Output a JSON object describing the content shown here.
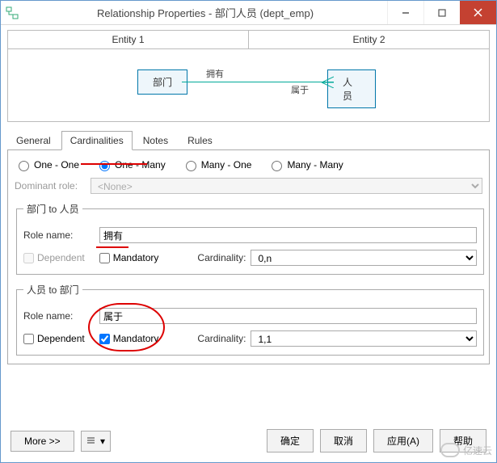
{
  "window": {
    "title": "Relationship Properties - 部门人员 (dept_emp)"
  },
  "entity_header": {
    "e1": "Entity 1",
    "e2": "Entity 2"
  },
  "diagram": {
    "left_entity": "部门",
    "right_entity": "人员",
    "label_left": "拥有",
    "label_right": "属于"
  },
  "tabs": [
    "General",
    "Cardinalities",
    "Notes",
    "Rules"
  ],
  "active_tab": "Cardinalities",
  "cardinality_options": {
    "one_one": "One - One",
    "one_many": "One - Many",
    "many_one": "Many - One",
    "many_many": "Many - Many",
    "selected": "one_many"
  },
  "dominant_role": {
    "label": "Dominant role:",
    "value": "<None>"
  },
  "section_a": {
    "legend": "部门 to 人员",
    "role_label": "Role name:",
    "role_value": "拥有",
    "dependent_label": "Dependent",
    "dependent_checked": false,
    "dependent_enabled": false,
    "mandatory_label": "Mandatory",
    "mandatory_checked": false,
    "cardinality_label": "Cardinality:",
    "cardinality_value": "0,n"
  },
  "section_b": {
    "legend": "人员 to 部门",
    "role_label": "Role name:",
    "role_value": "属于",
    "dependent_label": "Dependent",
    "dependent_checked": false,
    "dependent_enabled": true,
    "mandatory_label": "Mandatory",
    "mandatory_checked": true,
    "cardinality_label": "Cardinality:",
    "cardinality_value": "1,1"
  },
  "footer": {
    "more": "More >>",
    "ok": "确定",
    "cancel": "取消",
    "apply": "应用(A)",
    "help": "帮助"
  },
  "watermark": "亿速云"
}
